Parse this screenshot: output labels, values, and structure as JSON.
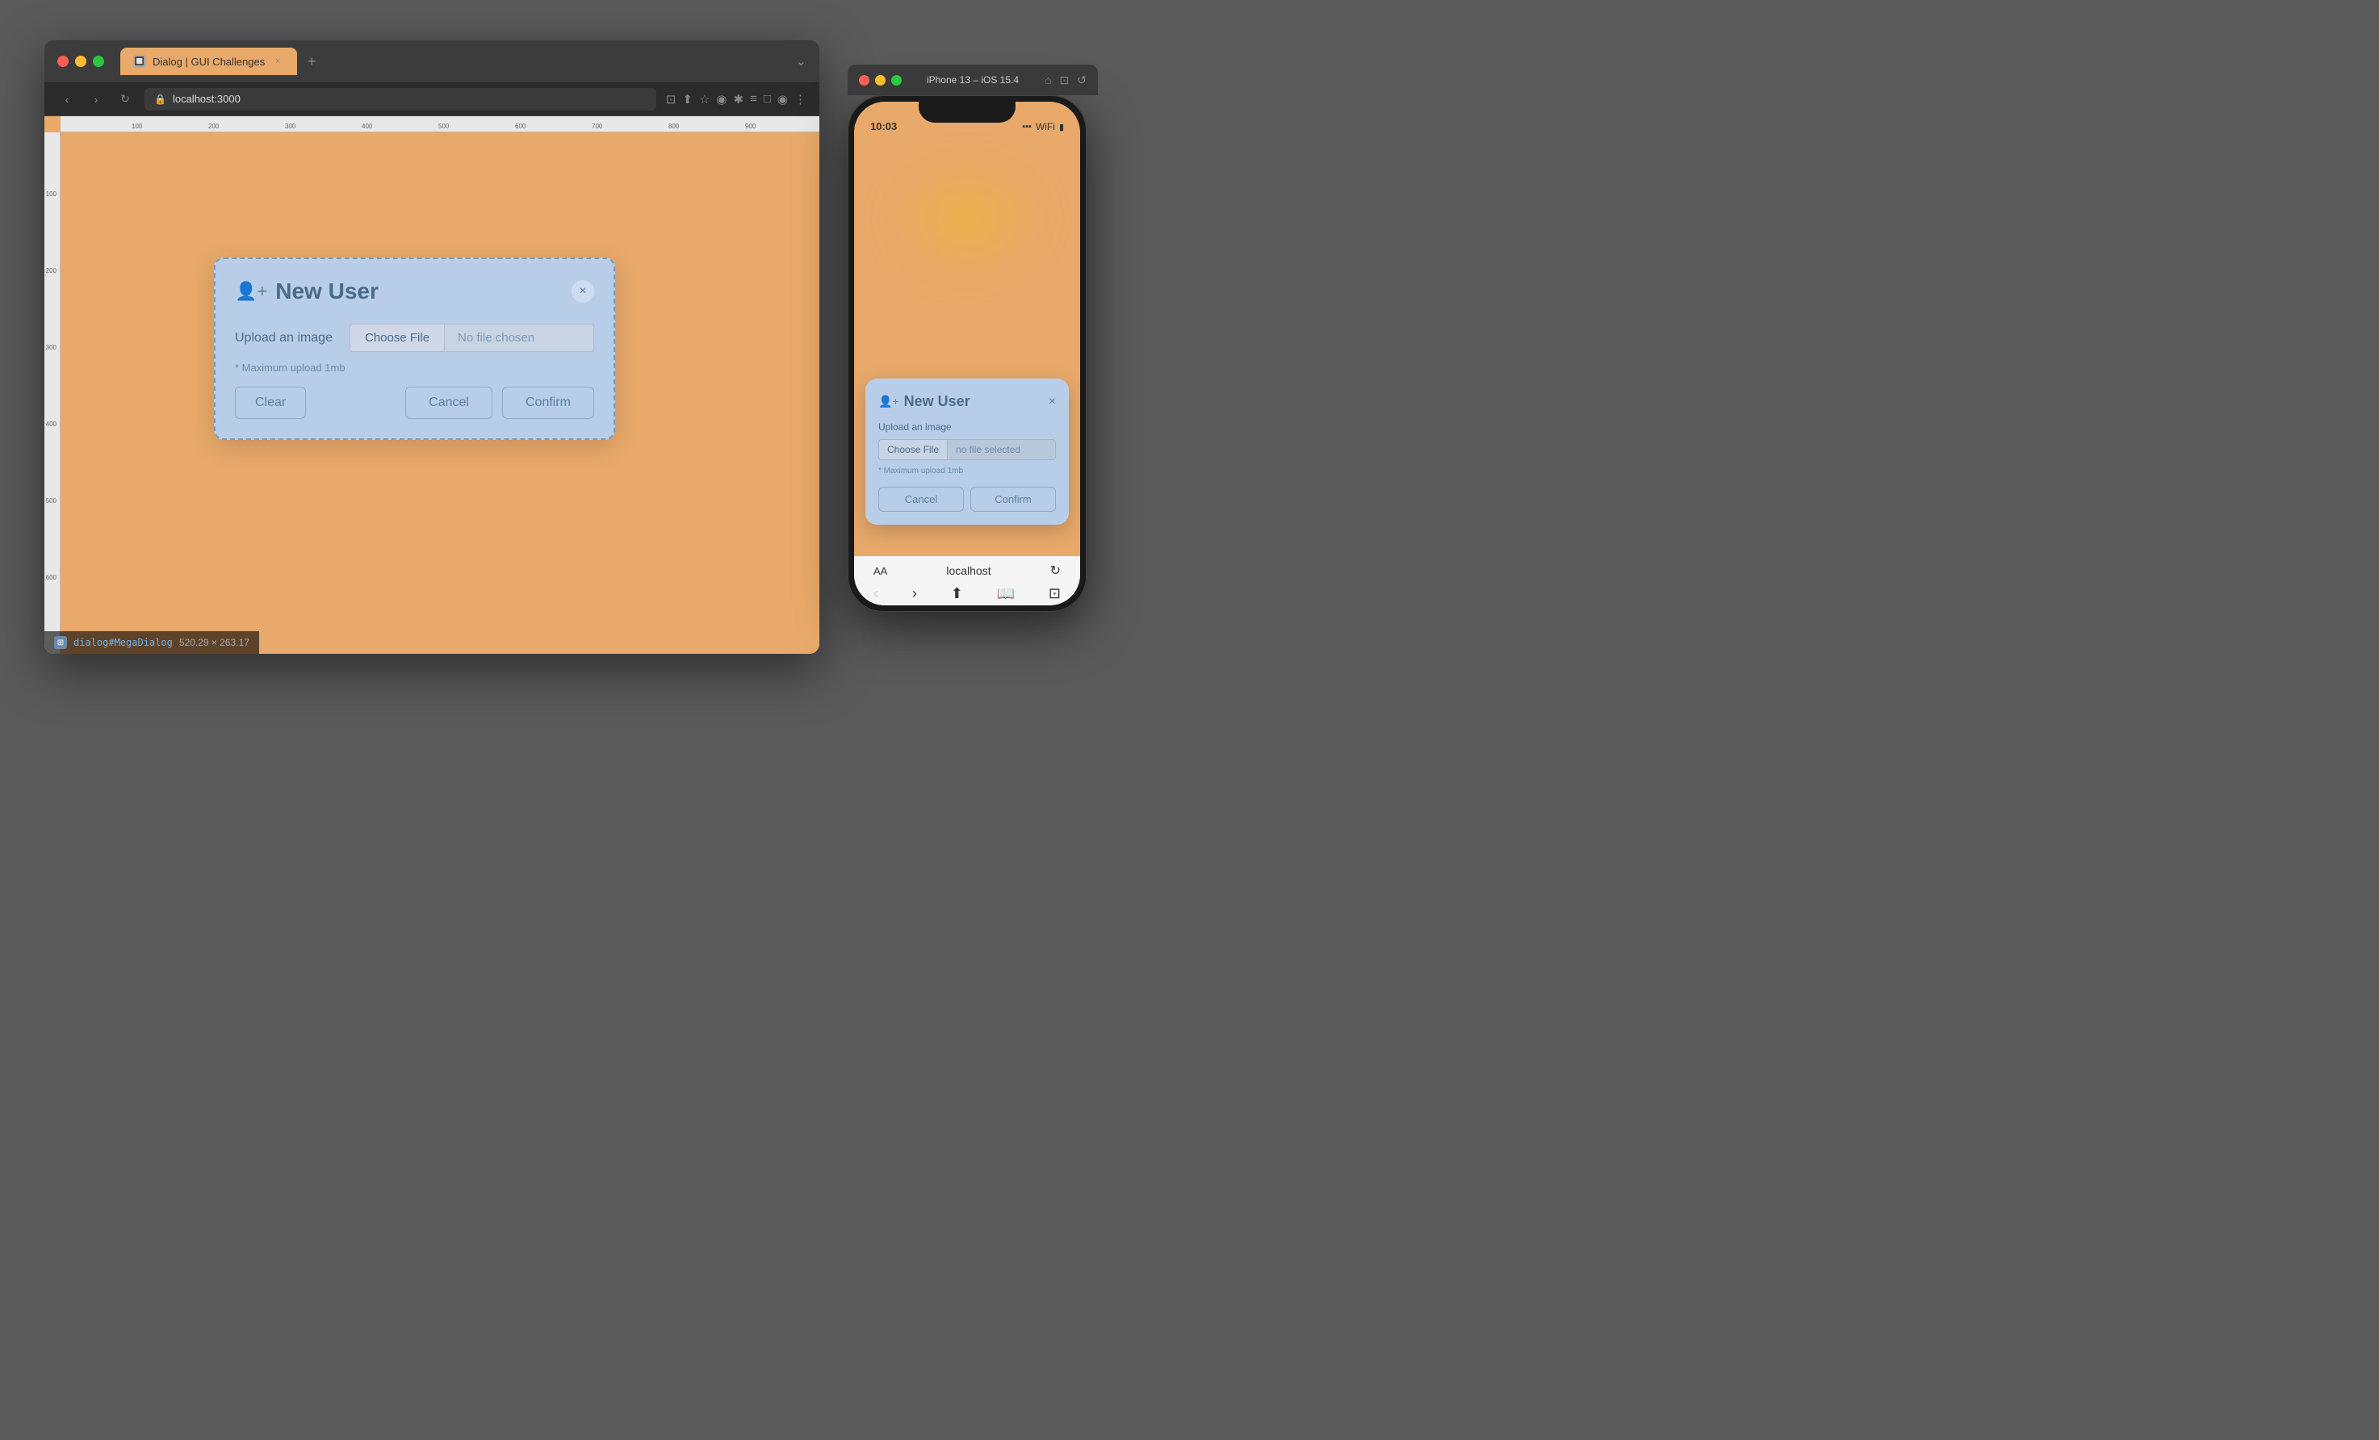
{
  "browser": {
    "tab_title": "Dialog | GUI Challenges",
    "tab_close": "×",
    "tab_new": "+",
    "window_controls_right": "⌄",
    "url": "localhost:3000",
    "nav": {
      "back": "‹",
      "forward": "›",
      "refresh": "↻"
    },
    "toolbar_icons": [
      "⊡",
      "⬆",
      "☆",
      "◉",
      "✱",
      "≡",
      "□",
      "◉",
      "⋮"
    ],
    "content_bg": "#e8a96a",
    "ruler_marks": [
      "100",
      "200",
      "300",
      "400",
      "500",
      "600",
      "700",
      "800",
      "900"
    ],
    "ruler_left_marks": [
      "100",
      "200",
      "300",
      "400",
      "500",
      "600"
    ],
    "status": {
      "selector": "dialog#MegaDialog",
      "size": "520.29 × 263.17"
    }
  },
  "dialog": {
    "icon": "👤",
    "title": "New User",
    "close_icon": "×",
    "upload_label": "Upload an image",
    "choose_file_btn": "Choose File",
    "no_file_text": "No file chosen",
    "hint": "* Maximum upload 1mb",
    "clear_btn": "Clear",
    "cancel_btn": "Cancel",
    "confirm_btn": "Confirm"
  },
  "iphone": {
    "window_title": "iPhone 13 – iOS 15.4",
    "time": "10:03",
    "signal": "...",
    "wifi": "WiFi",
    "battery": "▮",
    "dialog": {
      "icon": "👤",
      "title": "New User",
      "close_icon": "×",
      "upload_label": "Upload an image",
      "choose_file_btn": "Choose File",
      "no_file_text": "no file selected",
      "hint": "* Maximum upload 1mb",
      "cancel_btn": "Cancel",
      "confirm_btn": "Confirm"
    },
    "bottom": {
      "aa": "AA",
      "url": "localhost",
      "reload": "↻"
    }
  }
}
